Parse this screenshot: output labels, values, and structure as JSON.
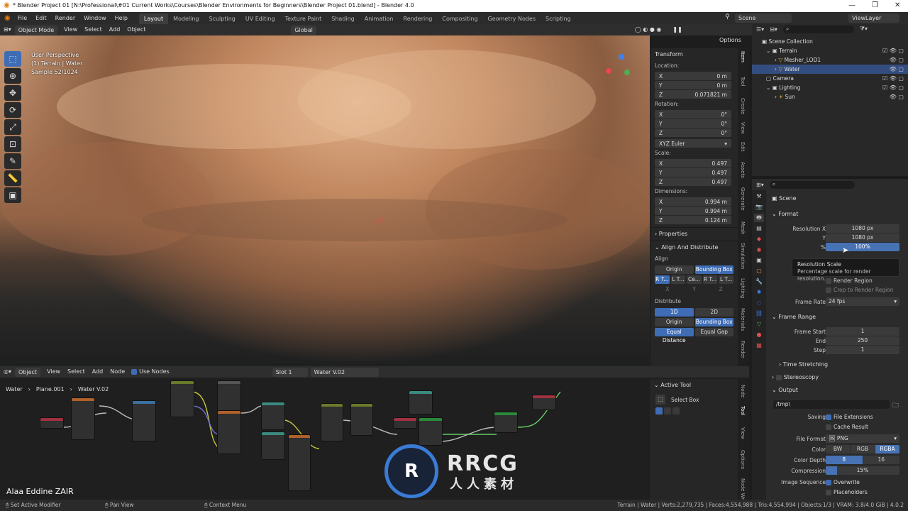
{
  "window": {
    "title": "* Blender Project 01 [N:\\Professional\\#01 Current Works\\Courses\\Blender Environments for Beginners\\Blender Project 01.blend] - Blender 4.0"
  },
  "menubar": {
    "items": [
      "File",
      "Edit",
      "Render",
      "Window",
      "Help"
    ],
    "workspaces": [
      "Layout",
      "Modeling",
      "Sculpting",
      "UV Editing",
      "Texture Paint",
      "Shading",
      "Animation",
      "Rendering",
      "Compositing",
      "Geometry Nodes",
      "Scripting"
    ],
    "active_workspace": "Layout",
    "scene": "Scene",
    "view_layer": "ViewLayer"
  },
  "viewport_header": {
    "mode": "Object Mode",
    "menus": [
      "View",
      "Select",
      "Add",
      "Object"
    ],
    "orientation": "Global",
    "options": "Options"
  },
  "viewport": {
    "perspective": "User Perspective",
    "context": "(1) Terrain | Water",
    "sample": "Sample 52/1024"
  },
  "npanel": {
    "transform": "Transform",
    "location_label": "Location:",
    "location": [
      {
        "axis": "X",
        "value": "0 m"
      },
      {
        "axis": "Y",
        "value": "0 m"
      },
      {
        "axis": "Z",
        "value": "0.071821 m"
      }
    ],
    "rotation_label": "Rotation:",
    "rotation": [
      {
        "axis": "X",
        "value": "0°"
      },
      {
        "axis": "Y",
        "value": "0°"
      },
      {
        "axis": "Z",
        "value": "0°"
      }
    ],
    "rotation_mode": "XYZ Euler",
    "scale_label": "Scale:",
    "scale": [
      {
        "axis": "X",
        "value": "0.497"
      },
      {
        "axis": "Y",
        "value": "0.497"
      },
      {
        "axis": "Z",
        "value": "0.497"
      }
    ],
    "dimensions_label": "Dimensions:",
    "dimensions": [
      {
        "axis": "X",
        "value": "0.994 m"
      },
      {
        "axis": "Y",
        "value": "0.994 m"
      },
      {
        "axis": "Z",
        "value": "0.124 m"
      }
    ],
    "properties": "Properties",
    "align_distribute": "Align And Distribute",
    "align": "Align",
    "origin": "Origin",
    "bounding_box": "Bounding Box",
    "align_buttons": [
      "R T...",
      "L T...",
      "Ce...",
      "R T...",
      "L T..."
    ],
    "xyz": [
      "X",
      "Y",
      "Z"
    ],
    "distribute": "Distribute",
    "d1": "1D",
    "d2": "2D",
    "equal_distance": "Equal Distance",
    "equal_gap": "Equal Gap",
    "tabs": [
      "Item",
      "Tool",
      "Create",
      "View",
      "Edit",
      "Assets",
      "Generate",
      "Mesh",
      "Simulation",
      "Lighting",
      "Materials",
      "Render"
    ]
  },
  "node_editor": {
    "editor": "Object",
    "menus": [
      "View",
      "Select",
      "Add",
      "Node"
    ],
    "use_nodes": "Use Nodes",
    "slot": "Slot 1",
    "material": "Water V.02",
    "breadcrumb": [
      "Water",
      "Plane.001",
      "Water V.02"
    ],
    "active_tool": "Active Tool",
    "select_box": "Select Box",
    "tabs": [
      "Node",
      "Tool",
      "View",
      "Options",
      "Node Wr"
    ]
  },
  "watermark": {
    "author": "Alaa Eddine ZAIR",
    "brand": "RRCG",
    "brand_sub": "人人素材"
  },
  "outliner": {
    "root": "Scene Collection",
    "items": [
      {
        "name": "Terrain",
        "indent": 1,
        "sel": false
      },
      {
        "name": "Mesher_LOD1",
        "indent": 2,
        "sel": false
      },
      {
        "name": "Water",
        "indent": 2,
        "sel": true
      },
      {
        "name": "Camera",
        "indent": 1,
        "sel": false
      },
      {
        "name": "Lighting",
        "indent": 1,
        "sel": false
      },
      {
        "name": "Sun",
        "indent": 2,
        "sel": false
      }
    ]
  },
  "properties": {
    "scene": "Scene",
    "format": "Format",
    "resolution_x_label": "Resolution X",
    "resolution_x": "1080 px",
    "y_label": "Y",
    "resolution_y": "1080 px",
    "pct_label": "%",
    "resolution_pct": "100%",
    "tooltip_title": "Resolution Scale",
    "tooltip_body": "Percentage scale for render resolution.",
    "render_region": "Render Region",
    "crop_region": "Crop to Render Region",
    "frame_rate_label": "Frame Rate",
    "frame_rate": "24 fps",
    "frame_range": "Frame Range",
    "frame_start_label": "Frame Start",
    "frame_start": "1",
    "end_label": "End",
    "frame_end": "250",
    "step_label": "Step",
    "frame_step": "1",
    "time_stretching": "Time Stretching",
    "stereoscopy": "Stereoscopy",
    "output": "Output",
    "output_path": "/tmp\\",
    "saving_label": "Saving",
    "file_extensions": "File Extensions",
    "cache_result": "Cache Result",
    "file_format_label": "File Format",
    "file_format": "PNG",
    "color_label": "Color",
    "color_modes": [
      "BW",
      "RGB",
      "RGBA"
    ],
    "color_depth_label": "Color Depth",
    "color_depths": [
      "8",
      "16"
    ],
    "compression_label": "Compression",
    "compression": "15%",
    "compression_value": 0.15,
    "image_sequence_label": "Image Sequence",
    "overwrite": "Overwrite",
    "placeholders": "Placeholders"
  },
  "statusbar": {
    "left": [
      "Set Active Modifier",
      "Pan View",
      "Context Menu"
    ],
    "right": "Terrain | Water | Verts:2,279,735 | Faces:4,554,988 | Tris:4,554,994 | Objects:1/3 | VRAM: 3.8/4.0 GiB | 4.0.2"
  },
  "colors": {
    "accent": "#3f6db5",
    "selection": "#334d80"
  }
}
